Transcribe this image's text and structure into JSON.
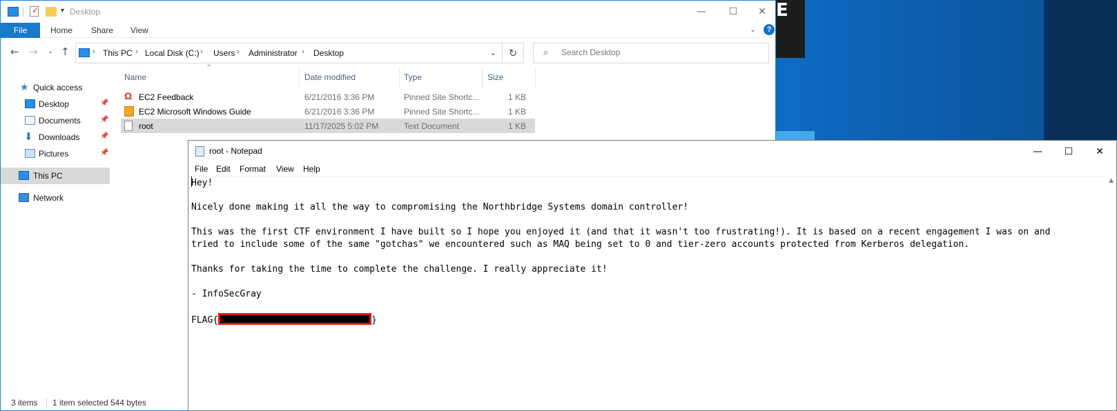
{
  "explorer": {
    "title": "Desktop",
    "ribbon_tabs": [
      "File",
      "Home",
      "Share",
      "View"
    ],
    "breadcrumb": [
      "This PC",
      "Local Disk (C:)",
      "Users",
      "Administrator",
      "Desktop"
    ],
    "search_placeholder": "Search Desktop",
    "columns": [
      "Name",
      "Date modified",
      "Type",
      "Size"
    ],
    "files": [
      {
        "name": "EC2 Feedback",
        "date": "6/21/2016 3:36 PM",
        "type": "Pinned Site Shortc...",
        "size": "1 KB",
        "icon": "ec2-feedback-icon"
      },
      {
        "name": "EC2 Microsoft Windows Guide",
        "date": "6/21/2016 3:36 PM",
        "type": "Pinned Site Shortc...",
        "size": "1 KB",
        "icon": "ec2-guide-icon"
      },
      {
        "name": "root",
        "date": "11/17/2025 5:02 PM",
        "type": "Text Document",
        "size": "1 KB",
        "icon": "text-document-icon"
      }
    ],
    "nav": {
      "quick_access": "Quick access",
      "desktop": "Desktop",
      "documents": "Documents",
      "downloads": "Downloads",
      "pictures": "Pictures",
      "this_pc": "This PC",
      "network": "Network"
    },
    "status": {
      "items": "3 items",
      "selected": "1 item selected",
      "size": "544 bytes"
    },
    "desktop_glyph": "E"
  },
  "notepad": {
    "title": "root - Notepad",
    "menu": [
      "File",
      "Edit",
      "Format",
      "View",
      "Help"
    ],
    "lines": [
      "Hey!",
      "",
      "Nicely done making it all the way to compromising the Northbridge Systems domain controller!",
      "",
      "This was the first CTF environment I have built so I hope you enjoyed it (and that it wasn't too frustrating!). It is based on a recent engagement I was on and",
      "tried to include some of the same \"gotchas\" we encountered such as MAQ being set to 0 and tier-zero accounts protected from Kerberos delegation.",
      "",
      "Thanks for taking the time to complete the challenge. I really appreciate it!",
      "",
      "- InfoSecGray",
      ""
    ],
    "flag_prefix": "FLAG{",
    "flag_suffix": "}"
  },
  "colors": {
    "accent": "#1979ca",
    "selection": "#d9d9d9",
    "redaction_border": "#e51414"
  }
}
